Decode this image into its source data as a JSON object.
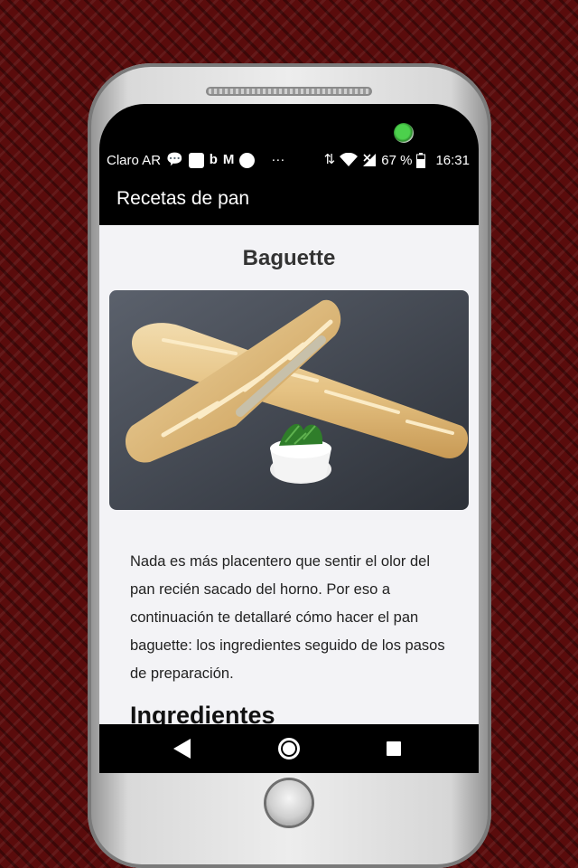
{
  "status_bar": {
    "carrier": "Claro AR",
    "battery": "67 %",
    "time": "16:31",
    "icons": [
      "chat-bubble-icon",
      "square-app-icon",
      "b-app-icon",
      "gmail-icon",
      "circle-app-icon",
      "more-icon",
      "data-arrows-icon",
      "wifi-icon",
      "signal-off-icon",
      "battery-icon"
    ]
  },
  "app_bar": {
    "title": "Recetas de pan"
  },
  "recipe": {
    "title": "Baguette",
    "image_alt": "baguette-photo",
    "intro": "Nada es más placentero que sentir el olor del pan recién sacado del horno. Por eso a continuación te detallaré cómo hacer el pan baguette: los ingredientes seguido de los pasos de preparación.",
    "section_heading": "Ingredientes"
  },
  "nav_bar": {
    "icons": [
      "back-icon",
      "home-icon",
      "recent-apps-icon"
    ]
  },
  "colors": {
    "background": "#5a0c0c",
    "content_bg": "#f3f3f6",
    "bars": "#000000",
    "camera_led": "#4cd14c"
  }
}
